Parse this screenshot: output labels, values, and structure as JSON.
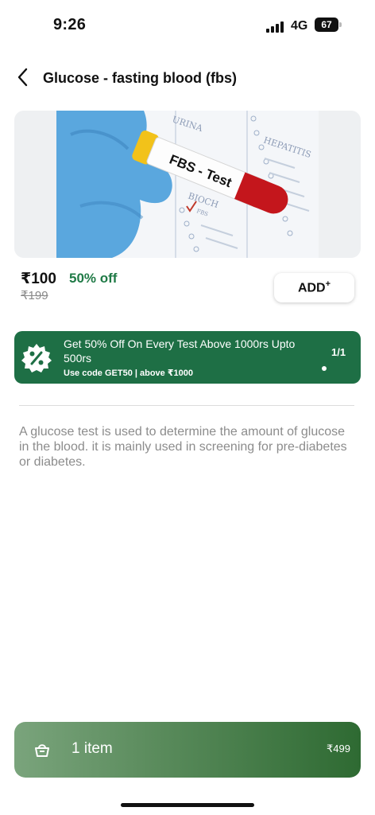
{
  "status_bar": {
    "time": "9:26",
    "network": "4G",
    "battery": "67"
  },
  "header": {
    "back_icon": "chevron-left-icon",
    "title": "Glucose - fasting blood (fbs)"
  },
  "hero": {
    "tube_label": "FBS - Test",
    "form_lines": [
      "URINA",
      "HEPATITIS",
      "BIOCH",
      "FBS"
    ]
  },
  "pricing": {
    "price": "₹100",
    "discount": "50% off",
    "mrp": "₹199",
    "add_label": "ADD",
    "add_sup": "+"
  },
  "offer": {
    "icon": "percent-badge-icon",
    "title": "Get 50% Off On Every Test Above 1000rs Upto 500rs",
    "code_text": "Use code GET50 | above ₹1000",
    "pager": "1/1"
  },
  "description": "A glucose test is used to determine the amount of glucose in the blood. it is mainly used in screening for pre-diabetes or diabetes.",
  "cart": {
    "icon": "basket-icon",
    "count_label": "1 item",
    "total": "₹499"
  },
  "colors": {
    "brand_green": "#1e6f45",
    "discount_green": "#1f7a46"
  }
}
